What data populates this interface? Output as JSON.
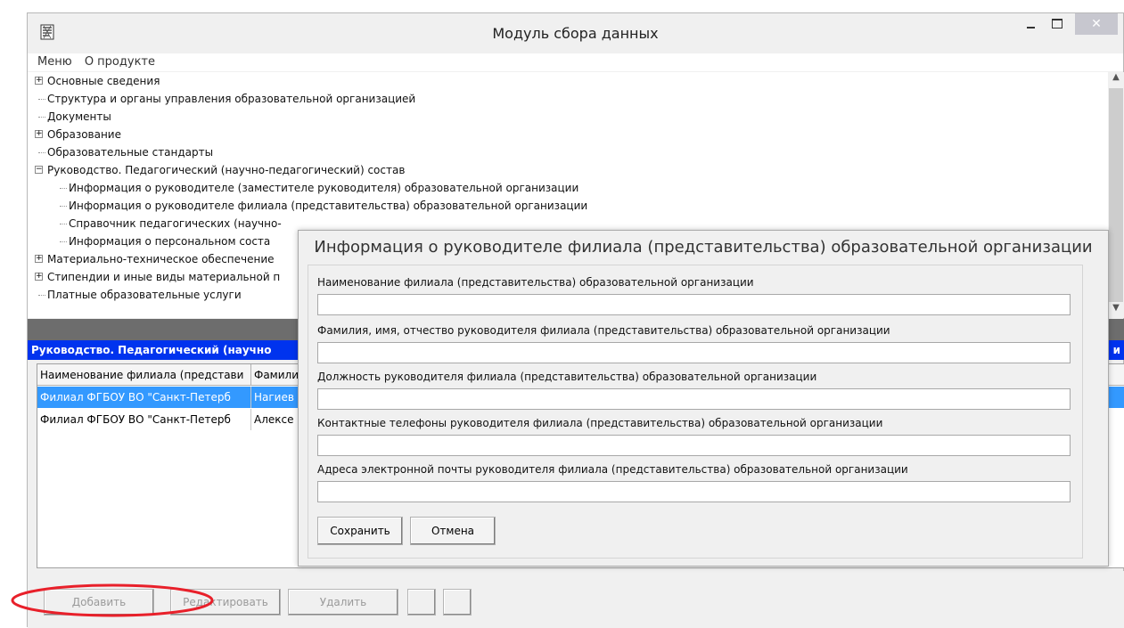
{
  "window": {
    "title": "Модуль сбора данных",
    "close_glyph": "✕"
  },
  "menu": {
    "items": [
      "Меню",
      "О продукте"
    ]
  },
  "tree": {
    "items": [
      {
        "label": "Основные сведения",
        "level": 0,
        "expander": "+"
      },
      {
        "label": "Структура и органы управления образовательной организацией",
        "level": 0,
        "expander": ""
      },
      {
        "label": "Документы",
        "level": 0,
        "expander": ""
      },
      {
        "label": "Образование",
        "level": 0,
        "expander": "+"
      },
      {
        "label": "Образовательные стандарты",
        "level": 0,
        "expander": ""
      },
      {
        "label": "Руководство. Педагогический (научно-педагогический) состав",
        "level": 0,
        "expander": "−"
      },
      {
        "label": "Информация о руководителе (заместителе руководителя) образовательной организации",
        "level": 1,
        "expander": ""
      },
      {
        "label": "Информация о руководителе филиала (представительства) образовательной организации",
        "level": 1,
        "expander": ""
      },
      {
        "label": "Справочник педагогических (научно-",
        "level": 1,
        "expander": ""
      },
      {
        "label": "Информация о персональном соста",
        "level": 1,
        "expander": ""
      },
      {
        "label": "Материально-техническое обеспечение",
        "level": 0,
        "expander": "+"
      },
      {
        "label": "Стипендии и иные виды материальной п",
        "level": 0,
        "expander": "+"
      },
      {
        "label": "Платные образовательные услуги",
        "level": 0,
        "expander": ""
      }
    ]
  },
  "section_header": {
    "text": "Руководство. Педагогический (научно",
    "tail": "и"
  },
  "grid": {
    "columns": [
      "Наименование филиала (представи",
      "Фамили"
    ],
    "rows": [
      {
        "cells": [
          "Филиал ФГБОУ ВО \"Санкт-Петерб",
          "Нагиев"
        ],
        "selected": true
      },
      {
        "cells": [
          "Филиал ФГБОУ ВО \"Санкт-Петерб",
          "Алексе"
        ],
        "selected": false
      }
    ]
  },
  "bottom_buttons": {
    "add": "Добавить",
    "edit": "Редактировать",
    "delete": "Удалить"
  },
  "dialog": {
    "title": "Информация о руководителе филиала (представительства) образовательной организации",
    "fields": [
      {
        "label": "Наименование филиала (представительства) образовательной организации",
        "value": ""
      },
      {
        "label": "Фамилия, имя, отчество руководителя филиала (представительства) образовательной организации",
        "value": ""
      },
      {
        "label": "Должность руководителя филиала (представительства) образовательной организации",
        "value": ""
      },
      {
        "label": "Контактные телефоны руководителя филиала (представительства) образовательной организации",
        "value": ""
      },
      {
        "label": "Адреса электронной почты руководителя филиала (представительства) образовательной организации",
        "value": ""
      }
    ],
    "save": "Сохранить",
    "cancel": "Отмена"
  },
  "colors": {
    "section_header_bg": "#0033ee",
    "selected_row_bg": "#3399ff",
    "annotation": "#e8202a"
  }
}
